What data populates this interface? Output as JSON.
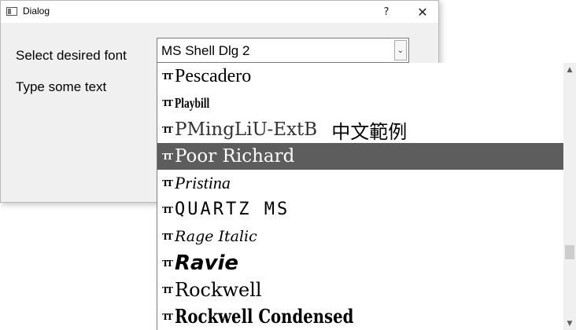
{
  "window": {
    "title": "Dialog",
    "help_button": "?",
    "close_button": "✕"
  },
  "form": {
    "font_label": "Select desired font",
    "text_label": "Type some text",
    "font_combo": {
      "value": "MS Shell Dlg 2",
      "arrow": "⌄"
    }
  },
  "dropdown": {
    "items": [
      {
        "label": "Pescadero",
        "sample": "",
        "selected": false,
        "icon": "truetype-font-icon"
      },
      {
        "label": "Playbill",
        "sample": "",
        "selected": false,
        "icon": "truetype-font-icon"
      },
      {
        "label": "PMingLiU-ExtB",
        "sample": "中文範例",
        "selected": false,
        "icon": "truetype-font-icon"
      },
      {
        "label": "Poor Richard",
        "sample": "",
        "selected": true,
        "icon": "truetype-font-icon"
      },
      {
        "label": "Pristina",
        "sample": "",
        "selected": false,
        "icon": "truetype-font-icon"
      },
      {
        "label": "QUARTZ MS",
        "sample": "",
        "selected": false,
        "icon": "truetype-font-icon"
      },
      {
        "label": "Rage Italic",
        "sample": "",
        "selected": false,
        "icon": "truetype-font-icon"
      },
      {
        "label": "Ravie",
        "sample": "",
        "selected": false,
        "icon": "truetype-font-icon"
      },
      {
        "label": "Rockwell",
        "sample": "",
        "selected": false,
        "icon": "truetype-font-icon"
      },
      {
        "label": "Rockwell Condensed",
        "sample": "",
        "selected": false,
        "icon": "truetype-font-icon"
      }
    ],
    "icon_glyph": "TT",
    "scrollbar": {
      "up_arrow": "▲",
      "down_arrow": "▼"
    }
  },
  "colors": {
    "selected_background": "#5d5d5d",
    "selected_text": "#ffffff",
    "dialog_background": "#f0f0f0"
  }
}
